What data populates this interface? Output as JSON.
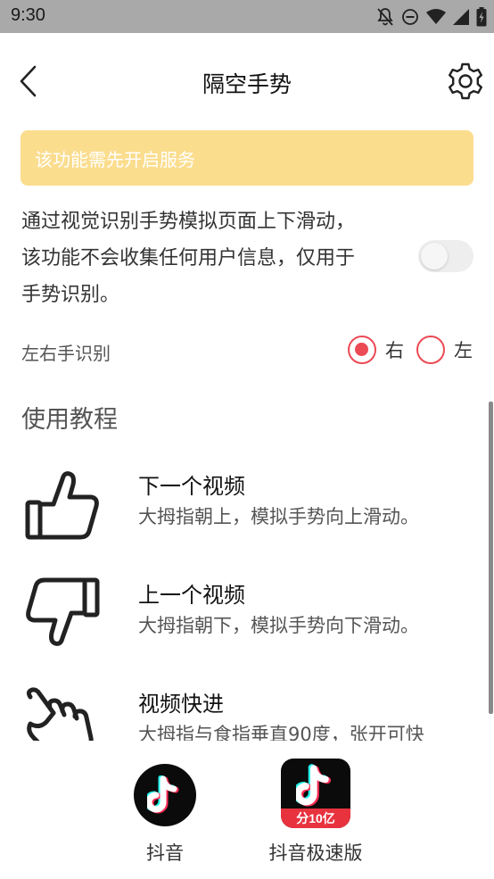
{
  "status_bar": {
    "time": "9:30",
    "icons": [
      "notifications-off-icon",
      "do-not-disturb-icon",
      "wifi-icon",
      "signal-icon",
      "battery-icon"
    ]
  },
  "header": {
    "title": "隔空手势",
    "back_icon": "chevron-left-icon",
    "settings_icon": "gear-icon"
  },
  "notice": {
    "text": "该功能需先开启服务",
    "background": "#fbdd8e"
  },
  "description": {
    "lines": [
      "通过视觉识别手势模拟页面上下滑动，",
      "该功能不会收集任何用户信息，仅用于",
      "手势识别。"
    ],
    "toggle_on": false
  },
  "hand_recognition": {
    "label": "左右手识别",
    "options": [
      {
        "label": "右",
        "selected": true
      },
      {
        "label": "左",
        "selected": false
      }
    ],
    "accent_color": "#ec4a55"
  },
  "tutorial": {
    "section_title": "使用教程",
    "items": [
      {
        "icon": "thumbs-up-icon",
        "title": "下一个视频",
        "desc": "大拇指朝上，模拟手势向上滑动。"
      },
      {
        "icon": "thumbs-down-icon",
        "title": "上一个视频",
        "desc": "大拇指朝下，模拟手势向下滑动。"
      },
      {
        "icon": "pointing-hand-icon",
        "title": "视频快进",
        "desc": "大拇指与食指垂直90度，张开可快"
      }
    ]
  },
  "share_apps": [
    {
      "name": "抖音",
      "icon": "douyin-app-icon"
    },
    {
      "name": "抖音极速版",
      "icon": "douyin-lite-app-icon",
      "badge": "分10亿"
    }
  ]
}
